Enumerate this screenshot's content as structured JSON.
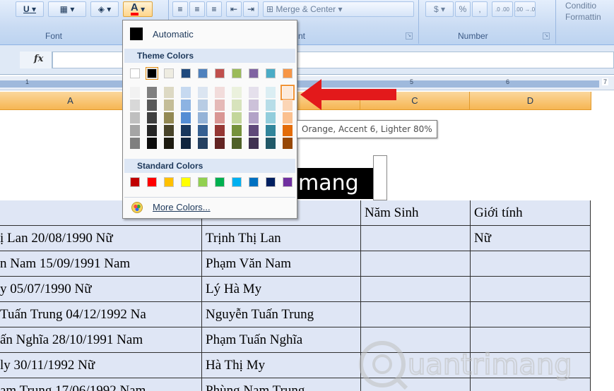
{
  "ribbon": {
    "font_group_label": "Font",
    "alignment_group_label": "nt",
    "number_group_label": "Number",
    "merge_center_label": "Merge & Center",
    "currency_symbol": "$",
    "percent_symbol": "%",
    "comma_symbol": ",",
    "inc_decimal_label": ".0 .00",
    "dec_decimal_label": ".00 →.0",
    "conditional_formatting_label_1": "Conditio",
    "conditional_formatting_label_2": "Formattin",
    "underline_label": "U",
    "font_color_label": "A",
    "font_color_current": "#ff0000"
  },
  "formula_bar": {
    "fx_label": "fx",
    "value": ""
  },
  "ruler": {
    "numbers": [
      "1",
      "2",
      "5",
      "6",
      "7"
    ]
  },
  "columns": {
    "a": "A",
    "c": "C",
    "d": "D"
  },
  "title_cell": {
    "text": "mang"
  },
  "table": {
    "header": {
      "year": "Năm Sinh",
      "gender": "Giới tính"
    },
    "rows": [
      {
        "raw": "ị Lan 20/08/1990 Nữ",
        "name": "Trịnh Thị Lan",
        "year": "",
        "gender": "Nữ"
      },
      {
        "raw": "n Nam 15/09/1991 Nam",
        "name": "Phạm Văn Nam",
        "year": "",
        "gender": ""
      },
      {
        "raw": "y 05/07/1990 Nữ",
        "name": "Lý Hà My",
        "year": "",
        "gender": ""
      },
      {
        "raw": "Tuấn Trung 04/12/1992 Na",
        "name": "Nguyễn Tuấn Trung",
        "year": "",
        "gender": ""
      },
      {
        "raw": "ấn Nghĩa 28/10/1991 Nam",
        "name": "Phạm Tuấn Nghĩa",
        "year": "",
        "gender": ""
      },
      {
        "raw": "ly 30/11/1992 Nữ",
        "name": "Hà Thị My",
        "year": "",
        "gender": ""
      },
      {
        "raw": "am Trung 17/06/1992 Nam",
        "name": "Phùng Nam Trung",
        "year": "",
        "gender": ""
      }
    ]
  },
  "color_menu": {
    "automatic_label": "Automatic",
    "theme_colors_label": "Theme Colors",
    "standard_colors_label": "Standard Colors",
    "more_colors_label": "More Colors...",
    "theme_base": [
      "#ffffff",
      "#000000",
      "#eeece1",
      "#1f497d",
      "#4f81bd",
      "#c0504d",
      "#9bbb59",
      "#8064a2",
      "#4bacc6",
      "#f79646"
    ],
    "theme_shades": [
      [
        "#f2f2f2",
        "#7f7f7f",
        "#ddd9c3",
        "#c6d9f0",
        "#dbe5f1",
        "#f2dcdb",
        "#ebf1dd",
        "#e5e0ec",
        "#dbeef3",
        "#fdeada"
      ],
      [
        "#d8d8d8",
        "#595959",
        "#c4bd97",
        "#8db3e2",
        "#b8cce4",
        "#e5b9b7",
        "#d7e3bc",
        "#ccc1d9",
        "#b7dde8",
        "#fbd5b5"
      ],
      [
        "#bfbfbf",
        "#3f3f3f",
        "#938953",
        "#548dd4",
        "#95b3d7",
        "#d99694",
        "#c3d69b",
        "#b2a2c7",
        "#92cddc",
        "#fac08f"
      ],
      [
        "#a5a5a5",
        "#262626",
        "#494429",
        "#17365d",
        "#366092",
        "#953734",
        "#76923c",
        "#5f497a",
        "#31859b",
        "#e36c09"
      ],
      [
        "#7f7f7f",
        "#0c0c0c",
        "#1d1b10",
        "#0f243e",
        "#244061",
        "#632423",
        "#4f6128",
        "#3f3151",
        "#205867",
        "#974806"
      ]
    ],
    "standard": [
      "#c00000",
      "#ff0000",
      "#ffc000",
      "#ffff00",
      "#92d050",
      "#00b050",
      "#00b0f0",
      "#0070c0",
      "#002060",
      "#7030a0"
    ],
    "selected_swatch": "Black",
    "hovered_swatch_tooltip": "Orange, Accent 6, Lighter 80%"
  },
  "annotation": {
    "arrow_color": "#e3191b"
  },
  "watermark": {
    "text": "uantrimang"
  }
}
